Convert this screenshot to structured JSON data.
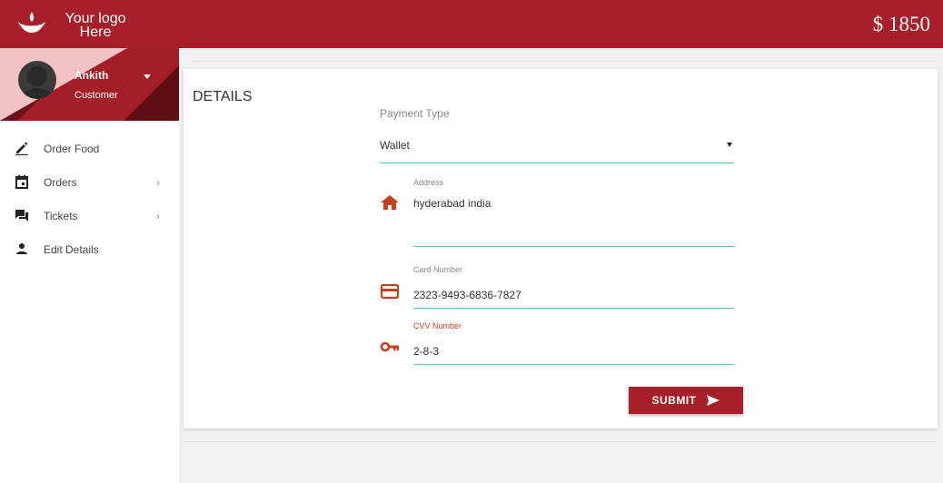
{
  "header": {
    "logo_line1": "Your logo",
    "logo_line2": "Here",
    "balance": "$ 1850",
    "brand_color": "#a71f29"
  },
  "profile": {
    "name": "Ankith",
    "role": "Customer"
  },
  "menu": [
    {
      "label": "Order Food",
      "icon": "pencil-icon",
      "has_submenu": false
    },
    {
      "label": "Orders",
      "icon": "calendar-icon",
      "has_submenu": true
    },
    {
      "label": "Tickets",
      "icon": "chat-icon",
      "has_submenu": true
    },
    {
      "label": "Edit Details",
      "icon": "person-icon",
      "has_submenu": false
    }
  ],
  "form": {
    "title": "DETAILS",
    "payment_type_label": "Payment Type",
    "payment_type_value": "Wallet",
    "address_label": "Address",
    "address_value": "hyderabad india",
    "card_label": "Card Number",
    "card_value": "2323-9493-6836-7827",
    "cvv_label": "CVV Number",
    "cvv_value": "2-8-3",
    "submit_label": "SUBMIT",
    "accent_color": "#50d29a",
    "icon_color": "#c0421e"
  }
}
